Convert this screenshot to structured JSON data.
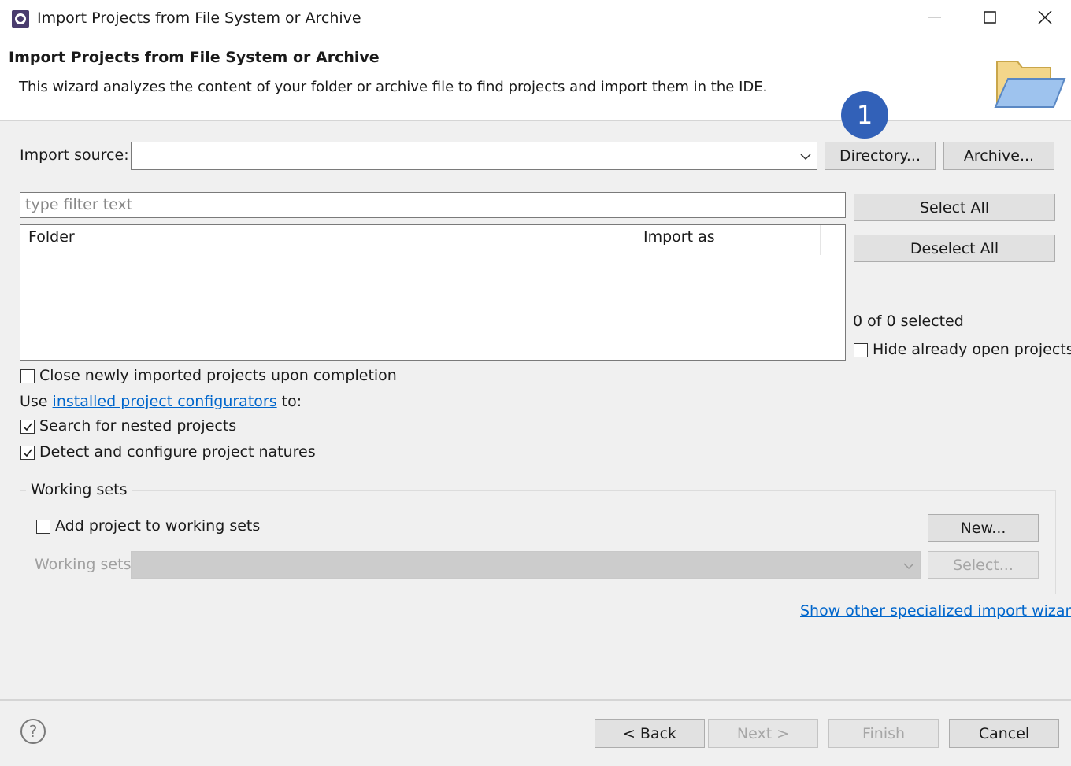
{
  "window": {
    "title": "Import Projects from File System or Archive",
    "minimize_icon": "minimize-icon",
    "maximize_icon": "maximize-icon",
    "close_icon": "close-icon"
  },
  "banner": {
    "title": "Import Projects from File System or Archive",
    "description": "This wizard analyzes the content of your folder or archive file to find projects and import them in the IDE.",
    "icon": "folder-icon",
    "badge": "1"
  },
  "import_source": {
    "label": "Import source:",
    "value": "",
    "directory_button": "Directory...",
    "archive_button": "Archive..."
  },
  "filter": {
    "placeholder": "type filter text"
  },
  "table": {
    "columns": [
      "Folder",
      "Import as"
    ],
    "rows": []
  },
  "side": {
    "select_all": "Select All",
    "deselect_all": "Deselect All",
    "selection_count": "0 of 0 selected",
    "hide_open_label": "Hide already open projects",
    "hide_open_checked": false
  },
  "options": {
    "close_imported_label": "Close newly imported projects upon completion",
    "close_imported_checked": false,
    "use_prefix": "Use",
    "configurators_link": "installed project configurators",
    "use_suffix": "to:",
    "search_nested_label": "Search for nested projects",
    "search_nested_checked": true,
    "detect_natures_label": "Detect and configure project natures",
    "detect_natures_checked": true
  },
  "working_sets": {
    "group_title": "Working sets",
    "add_label": "Add project to working sets",
    "add_checked": false,
    "new_button": "New...",
    "sets_label": "Working sets:",
    "select_button": "Select..."
  },
  "specialized_link": "Show other specialized import wizards",
  "footer": {
    "help_icon": "help-icon",
    "back": "< Back",
    "next": "Next >",
    "finish": "Finish",
    "cancel": "Cancel"
  },
  "colors": {
    "accent": "#3261b8",
    "link": "#0066cc",
    "background": "#f0f0f0"
  }
}
